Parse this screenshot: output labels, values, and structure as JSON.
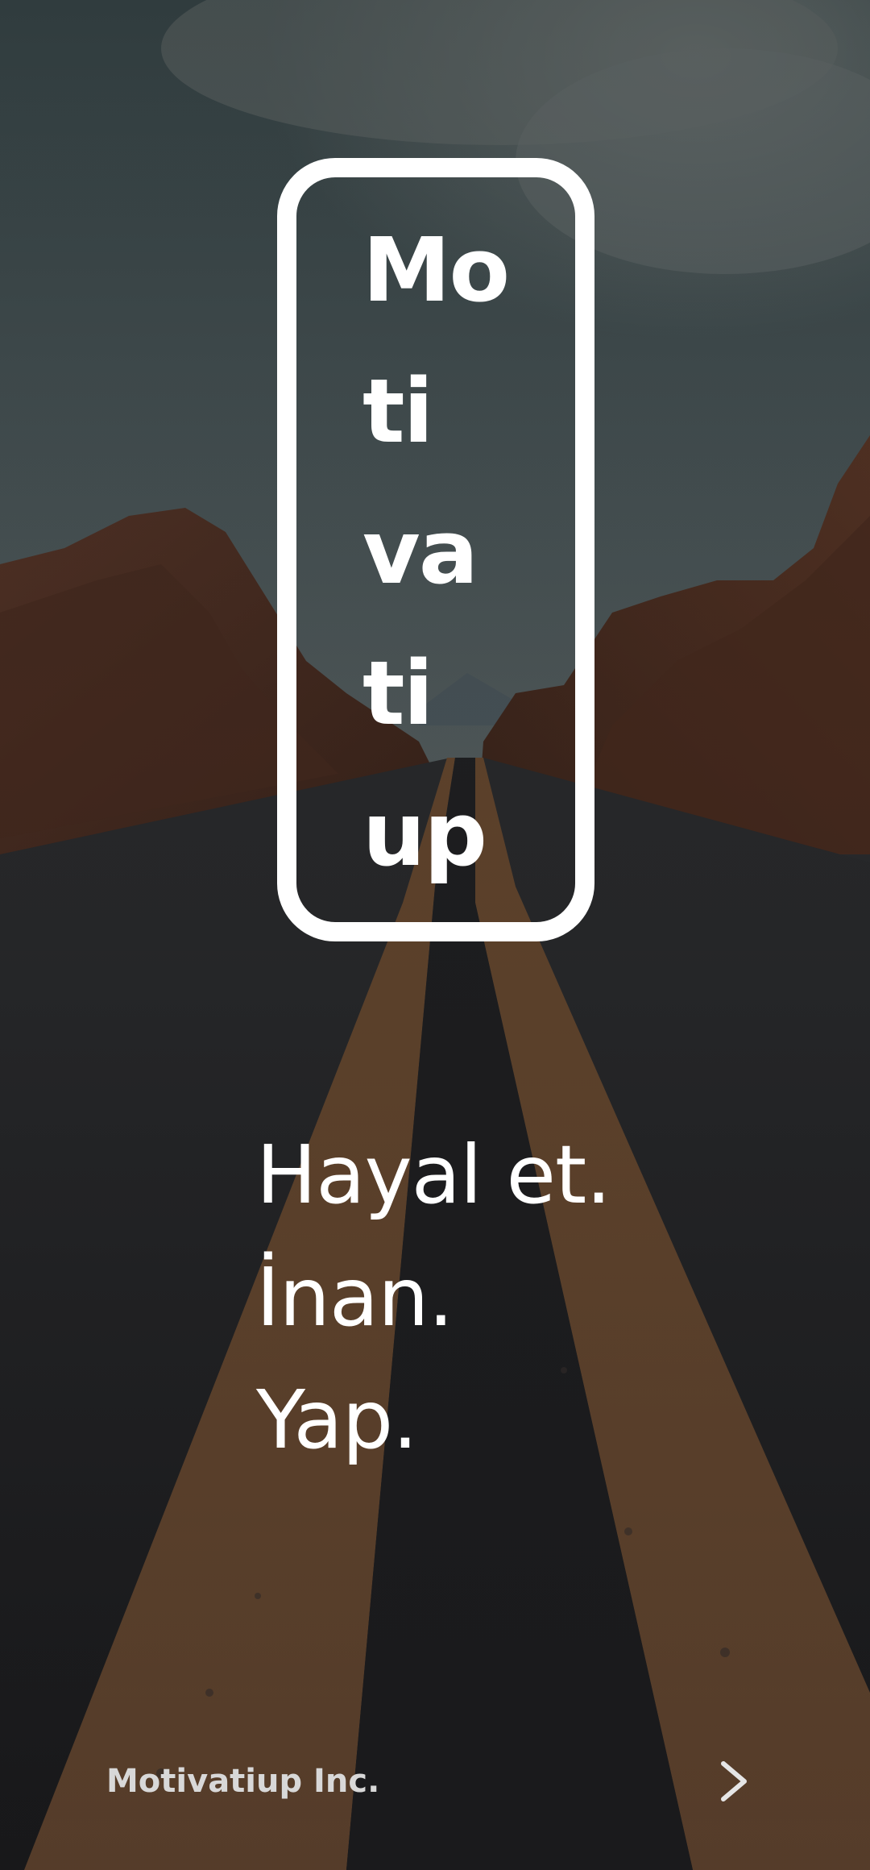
{
  "logo": {
    "lines": [
      "Mo",
      "ti",
      "va",
      "ti",
      "up"
    ]
  },
  "tagline": {
    "lines": [
      "Hayal et.",
      "İnan.",
      "Yap."
    ]
  },
  "footer": {
    "company": "Motivatiup Inc.",
    "next_icon": "chevron-right-icon"
  },
  "colors": {
    "text": "#ffffff",
    "footer_text": "#d8d8d8"
  }
}
